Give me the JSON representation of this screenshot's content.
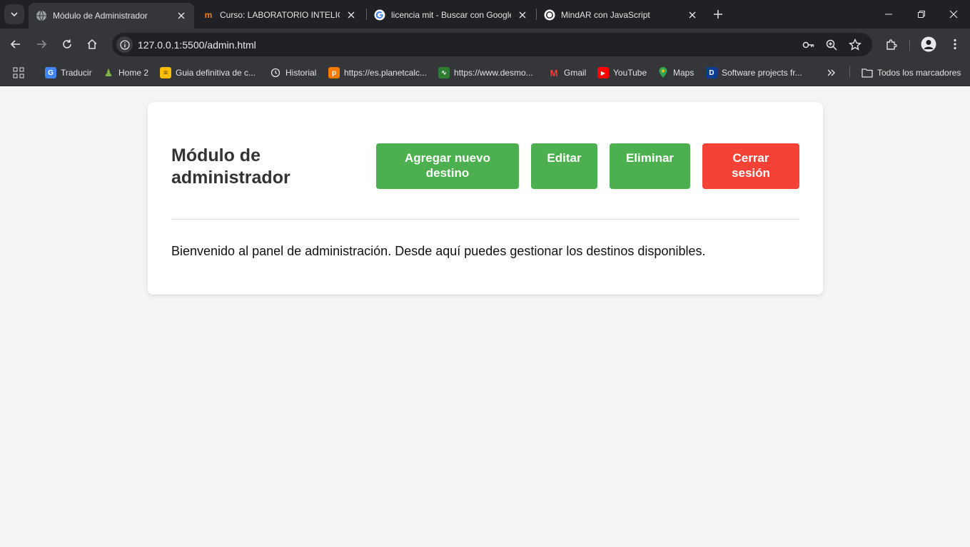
{
  "browser": {
    "tabs": [
      {
        "title": "Módulo de Administrador",
        "icon": "globe-icon",
        "active": true
      },
      {
        "title": "Curso: LABORATORIO INTELIGE",
        "icon": "moodle-icon",
        "active": false
      },
      {
        "title": "licencia mit - Buscar con Google",
        "icon": "google-icon",
        "active": false
      },
      {
        "title": "MindAR con JavaScript",
        "icon": "openai-icon",
        "active": false
      }
    ],
    "url": "127.0.0.1:5500/admin.html",
    "bookmarks": [
      {
        "label": "Traducir",
        "icon": "translate-icon",
        "color": "#4285f4"
      },
      {
        "label": "Home 2",
        "icon": "pawn-icon",
        "color": "#7cb342"
      },
      {
        "label": "Guia definitiva de c...",
        "icon": "sheet-icon",
        "color": "#fbbc04"
      },
      {
        "label": "Historial",
        "icon": "history-icon",
        "color": "#e3e3e3"
      },
      {
        "label": "https://es.planetcalc...",
        "icon": "planetcalc-icon",
        "color": "#f57c00"
      },
      {
        "label": "https://www.desmo...",
        "icon": "desmos-icon",
        "color": "#2e7d32"
      },
      {
        "label": "Gmail",
        "icon": "gmail-icon",
        "color": "#ea4335"
      },
      {
        "label": "YouTube",
        "icon": "youtube-icon",
        "color": "#ff0000"
      },
      {
        "label": "Maps",
        "icon": "maps-icon",
        "color": "#34a853"
      },
      {
        "label": "Software projects fr...",
        "icon": "dev-icon",
        "color": "#0b3d91"
      }
    ],
    "all_bookmarks_label": "Todos los marcadores"
  },
  "admin": {
    "title": "Módulo de administrador",
    "buttons": {
      "add": "Agregar nuevo destino",
      "edit": "Editar",
      "delete": "Eliminar",
      "logout": "Cerrar sesión"
    },
    "welcome": "Bienvenido al panel de administración. Desde aquí puedes gestionar los destinos disponibles."
  },
  "colors": {
    "primary_button": "#4caf50",
    "logout_button": "#f44336",
    "page_background": "#f4f4f4"
  }
}
